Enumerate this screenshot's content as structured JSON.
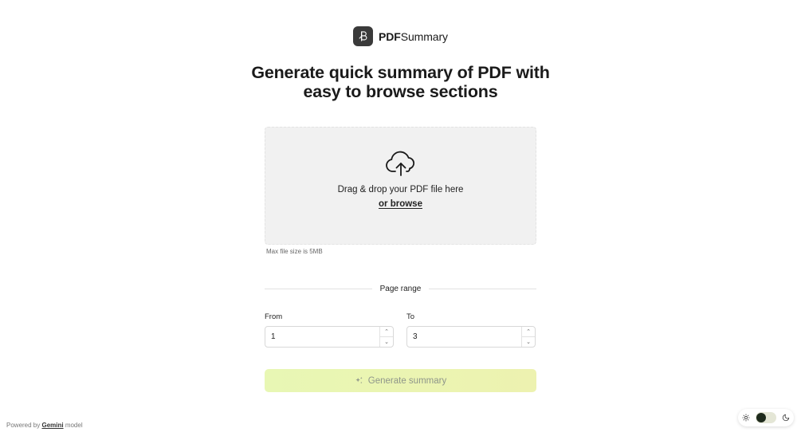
{
  "header": {
    "brand_bold": "PDF",
    "brand_rest": "Summary",
    "logo_icon": "pen-nib-icon"
  },
  "hero": {
    "line1_before": "Generate quick summary of ",
    "line1_bold": "PDF",
    "line1_after": " with",
    "line2": "easy to browse sections"
  },
  "upload": {
    "icon": "cloud-upload-icon",
    "drag_text": "Drag & drop your PDF file here",
    "browse_label": "or browse",
    "max_size_text": "Max file size is 5MB"
  },
  "page_range": {
    "title": "Page range",
    "from_label": "From",
    "from_value": "1",
    "to_label": "To",
    "to_value": "3"
  },
  "generate_button": {
    "label": "Generate summary",
    "icon": "sparkles-icon"
  },
  "footer": {
    "powered_prefix": "Powered by ",
    "powered_link": "Gemini",
    "powered_suffix": " model"
  },
  "theme": {
    "light_icon": "sun-icon",
    "dark_icon": "moon-icon"
  },
  "colors": {
    "accent_gradient_start": "#e8f7b4",
    "accent_gradient_end": "#edf2b0",
    "dropzone_bg": "#f1f1f1",
    "logo_bg": "#3a3a3a"
  }
}
